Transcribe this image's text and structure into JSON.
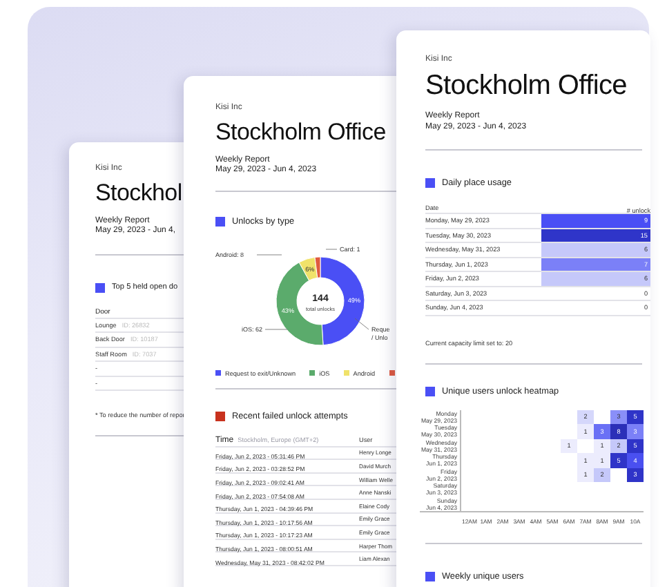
{
  "pages": [
    {
      "kind": "doors",
      "company": "Kisi Inc",
      "title": "Stockhol",
      "subtitle": "Weekly Report",
      "dates": "May 29, 2023 - Jun 4,",
      "section": {
        "title": "Top 5 held open do",
        "color": "#4a4ff5"
      },
      "column": "Door",
      "rows": [
        {
          "door": "Lounge",
          "id": "ID: 26832"
        },
        {
          "door": "Back Door",
          "id": "ID: 10187"
        },
        {
          "door": "Staff Room",
          "id": "ID: 7037"
        },
        {
          "door": "-"
        },
        {
          "door": "-"
        }
      ],
      "note": "* To reduce the number of repor"
    },
    {
      "kind": "unlocks",
      "company": "Kisi Inc",
      "title": "Stockholm Office",
      "subtitle": "Weekly Report",
      "dates": "May 29, 2023 - Jun 4, 2023",
      "section": {
        "title": "Unlocks by type",
        "color": "#4a4ff5"
      },
      "chart_data": {
        "type": "donut",
        "values": [
          49,
          43,
          6,
          2
        ],
        "colors": [
          "#4a4ff5",
          "#5bab6c",
          "#f0e26a",
          "#e05a3f"
        ]
      },
      "center_value": "144",
      "center_label": "total unlocks",
      "slice_labels": [
        "49%",
        "43%",
        "6%"
      ],
      "callouts": [
        [
          "Card: 1"
        ],
        [
          "Android: 8"
        ],
        [
          "iOS: 62"
        ],
        [
          "Reque",
          "/ Unlo"
        ]
      ],
      "legend": [
        {
          "label": "Request to exit/Unknown",
          "color": "#4a4ff5"
        },
        {
          "label": "iOS",
          "color": "#5bab6c"
        },
        {
          "label": "Android",
          "color": "#f0e26a"
        },
        {
          "color": "#e05a3f"
        }
      ],
      "section2": {
        "title": "Recent failed unlock attempts",
        "color": "#c8321e"
      },
      "table": {
        "columns": [
          "Time",
          "User"
        ],
        "timezone": "Stockholm, Europe (GMT+2)",
        "rows": [
          {
            "time": "Friday, Jun 2, 2023 - 05:31:46 PM",
            "user": "Henry Longe"
          },
          {
            "time": "Friday, Jun 2, 2023 - 03:28:52 PM",
            "user": "David Murch"
          },
          {
            "time": "Friday, Jun 2, 2023 - 09:02:41 AM",
            "user": "William Welle"
          },
          {
            "time": "Friday, Jun 2, 2023 - 07:54:08 AM",
            "user": "Anne Nanski"
          },
          {
            "time": "Thursday, Jun 1, 2023 - 04:39:46 PM",
            "user": "Elaine Cody"
          },
          {
            "time": "Thursday, Jun 1, 2023 - 10:17:56 AM",
            "user": "Emily Grace"
          },
          {
            "time": "Thursday, Jun 1, 2023 - 10:17:23 AM",
            "user": "Emily Grace"
          },
          {
            "time": "Thursday, Jun 1, 2023 - 08:00:51 AM",
            "user": "Harper Thom"
          },
          {
            "time": "Wednesday, May 31, 2023 - 08:42:02 PM",
            "user": "Liam Alexan"
          }
        ]
      }
    },
    {
      "kind": "usage",
      "company": "Kisi Inc",
      "title": "Stockholm Office",
      "subtitle": "Weekly Report",
      "dates": "May 29, 2023 - Jun 4, 2023",
      "section": {
        "title": "Daily place usage",
        "color": "#4a4ff5"
      },
      "columns": [
        "Date",
        "# unlock"
      ],
      "rows": [
        {
          "date": "Monday, May 29, 2023",
          "unlocks": "9",
          "color": "#4a4ff5"
        },
        {
          "date": "Tuesday, May 30, 2023",
          "unlocks": "15",
          "color": "#2f35c9"
        },
        {
          "date": "Wednesday, May 31, 2023",
          "unlocks": "6",
          "color": "#c5c8fa"
        },
        {
          "date": "Thursday, Jun 1, 2023",
          "unlocks": "7",
          "color": "#7b80f7"
        },
        {
          "date": "Friday, Jun 2, 2023",
          "unlocks": "6",
          "color": "#c5c8fa"
        },
        {
          "date": "Saturday, Jun 3, 2023",
          "unlocks": "0"
        },
        {
          "date": "Sunday, Jun 4, 2023",
          "unlocks": "0"
        }
      ],
      "capacity": "Current capacity limit set to: 20",
      "heatmap": {
        "title": "Unique users unlock heatmap",
        "color": "#4a4ff5",
        "hours": [
          "12AM",
          "1AM",
          "2AM",
          "3AM",
          "4AM",
          "5AM",
          "6AM",
          "7AM",
          "8AM",
          "9AM",
          "10A"
        ],
        "rows": [
          {
            "day": "Monday",
            "date": "May 29, 2023",
            "cells": [
              null,
              null,
              null,
              null,
              null,
              null,
              null,
              {
                "value": "2",
                "color": "#d5d7fb"
              },
              null,
              {
                "value": "3",
                "color": "#8a8ff8"
              },
              {
                "value": "5",
                "color": "#2f34c8"
              }
            ]
          },
          {
            "day": "Tuesday",
            "date": "May 30, 2023",
            "cells": [
              null,
              null,
              null,
              null,
              null,
              null,
              null,
              {
                "value": "1",
                "color": "#ececfd"
              },
              {
                "value": "3",
                "color": "#6a70f5"
              },
              {
                "value": "8",
                "color": "#2b2fb8"
              },
              {
                "value": "3",
                "color": "#7b80f7"
              }
            ]
          },
          {
            "day": "Wednesday",
            "date": "May 31, 2023",
            "cells": [
              null,
              null,
              null,
              null,
              null,
              null,
              {
                "value": "1",
                "color": "#ececfd"
              },
              null,
              {
                "value": "1",
                "color": "#ececfd"
              },
              {
                "value": "2",
                "color": "#c5c8fa"
              },
              {
                "value": "5",
                "color": "#2f34c8"
              }
            ]
          },
          {
            "day": "Thursday",
            "date": "Jun 1, 2023",
            "cells": [
              null,
              null,
              null,
              null,
              null,
              null,
              null,
              {
                "value": "1",
                "color": "#ececfd"
              },
              {
                "value": "1",
                "color": "#ececfd"
              },
              {
                "value": "5",
                "color": "#2f34c8"
              },
              {
                "value": "4",
                "color": "#4a50f0"
              }
            ]
          },
          {
            "day": "Friday",
            "date": "Jun 2, 2023",
            "cells": [
              null,
              null,
              null,
              null,
              null,
              null,
              null,
              {
                "value": "1",
                "color": "#ececfd"
              },
              {
                "value": "2",
                "color": "#c5c8fa"
              },
              null,
              {
                "value": "3",
                "color": "#2f34c8"
              }
            ]
          },
          {
            "day": "Saturday",
            "date": "Jun 3, 2023",
            "cells": [
              null,
              null,
              null,
              null,
              null,
              null,
              null,
              null,
              null,
              null,
              null
            ]
          },
          {
            "day": "Sunday",
            "date": "Jun 4, 2023",
            "cells": [
              null,
              null,
              null,
              null,
              null,
              null,
              null,
              null,
              null,
              null,
              null
            ]
          }
        ]
      },
      "section3": {
        "title": "Weekly unique users",
        "color": "#4a4ff5"
      }
    }
  ]
}
